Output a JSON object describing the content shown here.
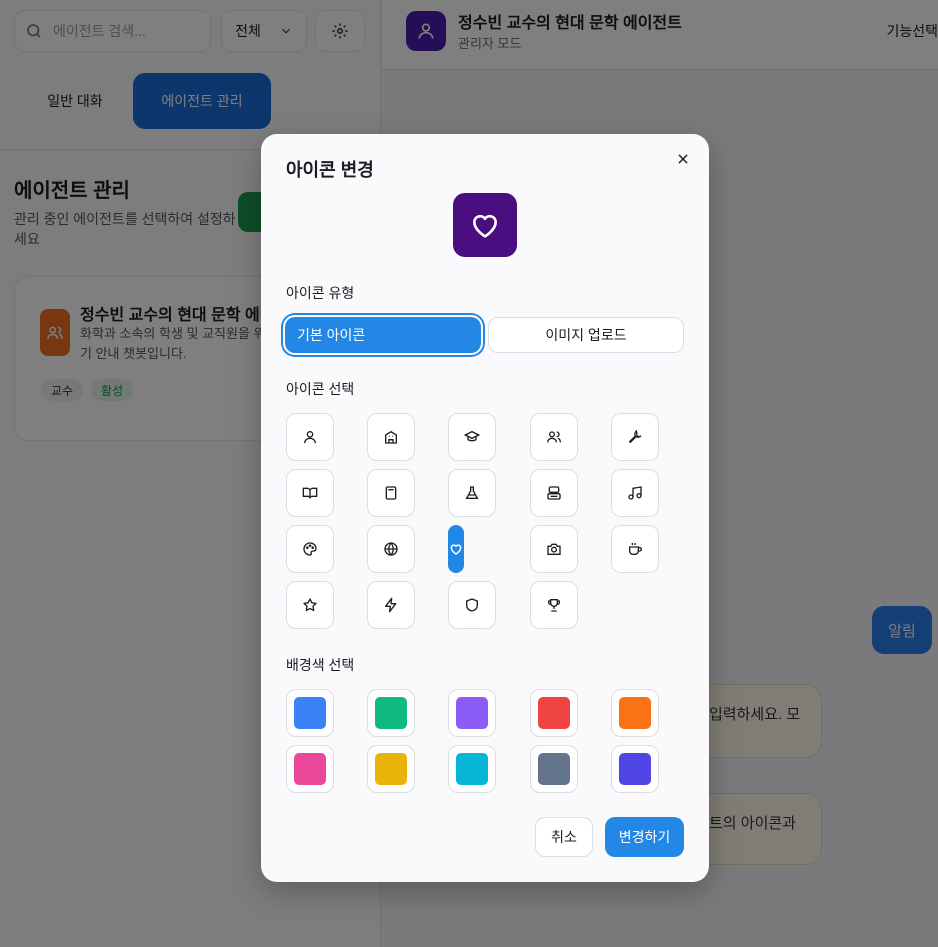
{
  "sidebar": {
    "search_placeholder": "에이전트 검색...",
    "filter_value": "전체",
    "tabs": [
      "일반 대화",
      "에이전트 관리"
    ],
    "section_title": "에이전트 관리",
    "section_desc": "관리 중인 에이전트를 선택하여 설정하세요",
    "agent_card": {
      "name": "정수빈 교수의 현대 문학 에이전트",
      "desc": "화학과 소속의 학생 및 교직원을 위한 에세이 채점기 안내 챗봇입니다.",
      "tags": [
        "교수",
        "활성"
      ]
    }
  },
  "header": {
    "title": "정수빈 교수의 현대 문학 에이전트",
    "subtitle": "관리자 모드",
    "feature_button": "기능선택"
  },
  "chat": {
    "notice_button": "알림",
    "bubble1": "입력하세요. 모",
    "bubble2": "트의 아이콘과"
  },
  "modal": {
    "title": "아이콘 변경",
    "preview_icon": "heart-icon",
    "preview_color": "#4a0e80",
    "icon_type_label": "아이콘 유형",
    "type_basic": "기본 아이콘",
    "type_upload": "이미지 업로드",
    "icon_select_label": "아이콘 선택",
    "icons": [
      "user",
      "building",
      "graduation-cap",
      "users",
      "wrench",
      "book",
      "calculator",
      "flask",
      "printer",
      "music",
      "palette",
      "globe",
      "heart",
      "camera",
      "coffee",
      "star",
      "zap",
      "shield",
      "trophy"
    ],
    "selected_icon": "heart",
    "color_label": "배경색 선택",
    "colors": [
      "#3b82f6",
      "#10b981",
      "#8b5cf6",
      "#ef4444",
      "#f97316",
      "#ec4899",
      "#eab308",
      "#06b6d4",
      "#64748b",
      "#4f46e5"
    ],
    "cancel": "취소",
    "confirm": "변경하기"
  }
}
